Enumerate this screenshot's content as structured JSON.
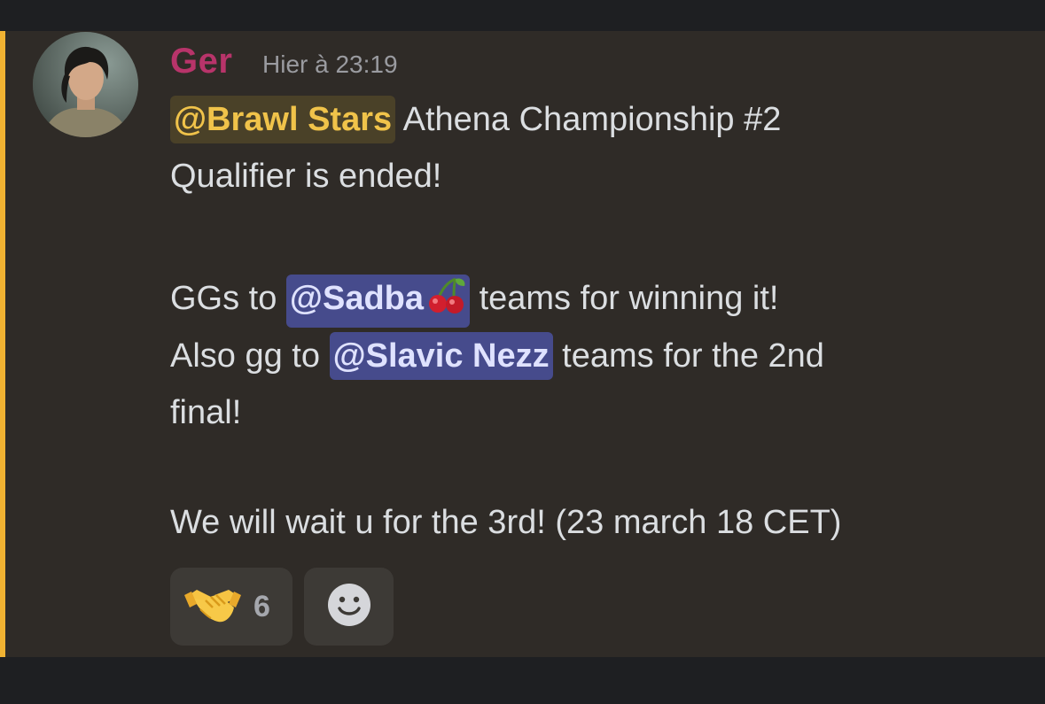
{
  "message": {
    "author": "Ger",
    "timestamp": "Hier à 23:19",
    "mention_role": "@Brawl Stars",
    "line1_rest": " Athena Championship #2",
    "line2": "Qualifier is ended!",
    "gg_prefix": "GGs to ",
    "mention_user1": "@Sadba",
    "mention_user1_emoji": "cherry-emoji",
    "gg_suffix": " teams for winning it!",
    "also_prefix": "Also gg to ",
    "mention_user2": "@Slavic Nezz",
    "also_suffix": " teams for the 2nd",
    "final_line": "final!",
    "closing_line": "We will wait u for the 3rd! (23 march 18 CET)"
  },
  "reactions": [
    {
      "emoji": "handshake-emoji",
      "count": "6"
    },
    {
      "emoji": "add-reaction-icon"
    }
  ],
  "colors": {
    "background": "#2f2b27",
    "highlight_bar": "#f0b232",
    "author": "#b8346a",
    "role_mention": "#f0c34a",
    "user_mention_bg": "#464b8c"
  }
}
